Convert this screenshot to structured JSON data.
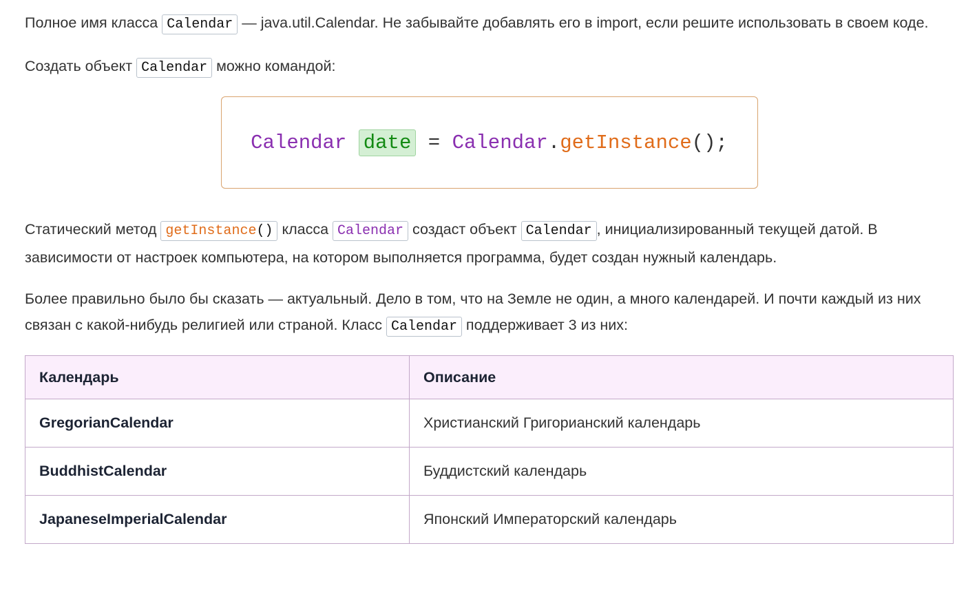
{
  "p1": {
    "t1": "Полное имя класса ",
    "code": "Calendar",
    "t2": " — java.util.Calendar. Не забывайте добавлять его в import, если решите использовать в своем коде."
  },
  "p2": {
    "t1": "Создать объект ",
    "code": "Calendar",
    "t2": " можно командой:"
  },
  "codeblock": {
    "type": "Calendar",
    "var": "date",
    "eq": "=",
    "cls": "Calendar",
    "dot": ".",
    "method": "getInstance",
    "end": "();"
  },
  "p3": {
    "t1": "Статический метод ",
    "method": "getInstance",
    "parens": "()",
    "t2": " класса ",
    "cls": "Calendar",
    "t3": " создаст объект ",
    "code": "Calendar",
    "t4": ", инициализированный текущей датой. В зависимости от настроек компьютера, на котором выполняется программа, будет создан нужный календарь."
  },
  "p4": {
    "t1": "Более правильно было бы сказать — актуальный. Дело в том, что на Земле не один, а много календарей. И почти каждый из них связан с какой-нибудь религией или страной. Класс ",
    "code": "Calendar",
    "t2": " поддерживает 3 из них:"
  },
  "table": {
    "headers": [
      "Календарь",
      "Описание"
    ],
    "rows": [
      [
        "GregorianCalendar",
        "Христианский Григорианский календарь"
      ],
      [
        "BuddhistCalendar",
        "Буддистский календарь"
      ],
      [
        "JapaneseImperialCalendar",
        "Японский Императорский календарь"
      ]
    ]
  }
}
